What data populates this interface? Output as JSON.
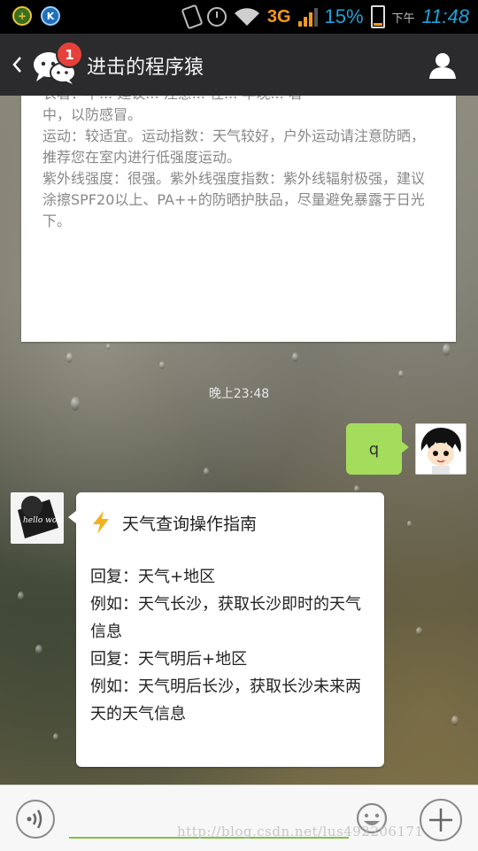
{
  "status_bar": {
    "network": "3G",
    "battery": "15%",
    "ampm": "下午",
    "time": "11:48"
  },
  "header": {
    "badge": "1",
    "title": "进击的程序猿"
  },
  "prev_message": {
    "text": "衣着：中... 建议... 注意... 在... 早晚... 着\n中，以防感冒。\n运动：较适宜。运动指数：天气较好，户外运动请注意防晒，推荐您在室内进行低强度运动。\n紫外线强度：很强。紫外线强度指数：紫外线辐射极强，建议涂擦SPF20以上、PA++的防晒护肤品，尽量避免暴露于日光下。"
  },
  "timestamp": "晚上23:48",
  "outgoing": {
    "text": "q"
  },
  "incoming": {
    "bot_avatar_text": "hello world",
    "title": "天气查询操作指南",
    "lines": [
      "回复：天气+地区",
      "例如：天气长沙，获取长沙即时的天气信息",
      "回复：天气明后+地区",
      "例如：天气明后长沙，获取长沙未来两天的天气信息"
    ]
  },
  "input": {
    "value": "",
    "placeholder": ""
  },
  "watermark": "http://blog.csdn.net/lus492206171",
  "colors": {
    "header_bg": "#2b2b2d",
    "badge": "#e5413b",
    "outgoing_bubble": "#a4dc5c",
    "input_underline": "#7fc243",
    "status_orange": "#f39a1c",
    "status_blue": "#1ea3d8"
  },
  "icons": [
    "back-icon",
    "wechat-chat-icon",
    "person-icon",
    "voice-icon",
    "emoji-icon",
    "plus-icon",
    "lightning-icon"
  ]
}
